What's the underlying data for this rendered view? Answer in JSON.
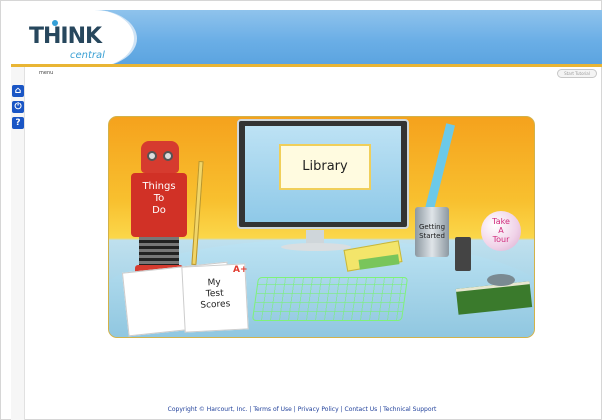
{
  "header": {
    "logo_main": "THINK",
    "logo_sub": "central"
  },
  "nav": {
    "label": "menu",
    "start_button": "Start Tutorial",
    "icons": [
      "home-icon",
      "power-icon",
      "help-icon"
    ]
  },
  "scene": {
    "library_label": "Library",
    "todo_label_line1": "Things",
    "todo_label_line2": "To",
    "todo_label_line3": "Do",
    "scores_line1": "My",
    "scores_line2": "Test",
    "scores_line3": "Scores",
    "grade": "A+",
    "getting_started_line1": "Getting",
    "getting_started_line2": "Started",
    "tour_line1": "Take",
    "tour_line2": "A",
    "tour_line3": "Tour"
  },
  "footer": {
    "copyright": "Copyright © Harcourt, Inc.",
    "sep": "|",
    "terms": "Terms of Use",
    "privacy": "Privacy Policy",
    "contact": "Contact Us",
    "support": "Technical Support"
  },
  "colors": {
    "header_blue": "#6aaee6",
    "accent_gold": "#e9b534",
    "link_blue": "#1f3f9a",
    "button_blue": "#1a56c5"
  }
}
